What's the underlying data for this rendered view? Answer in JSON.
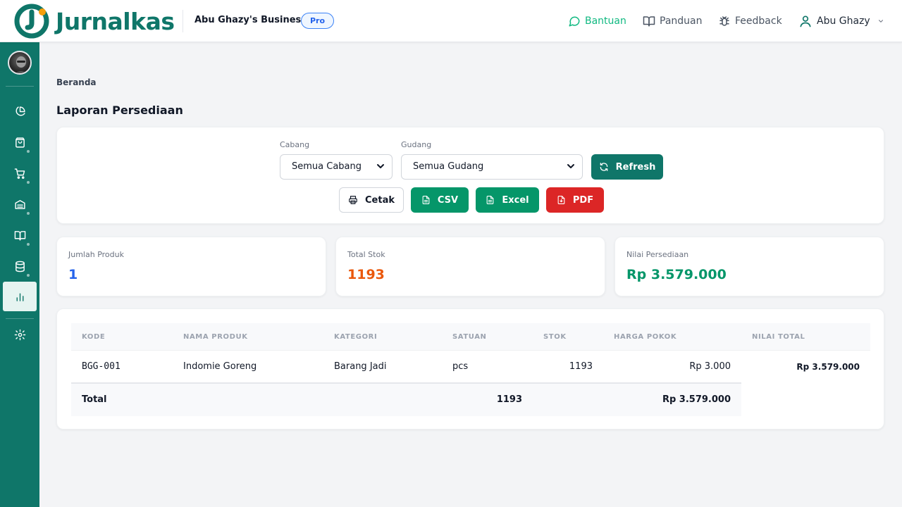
{
  "header": {
    "logo_text": "Jurnalkas",
    "business_name": "Abu Ghazy's Business",
    "plan_badge": "Pro",
    "links": {
      "bantuan": "Bantuan",
      "panduan": "Panduan",
      "feedback": "Feedback"
    },
    "user_name": "Abu Ghazy"
  },
  "sidebar": {
    "items": [
      {
        "icon": "pie-chart-icon"
      },
      {
        "icon": "shopping-bag-icon"
      },
      {
        "icon": "cart-icon"
      },
      {
        "icon": "archive-icon"
      },
      {
        "icon": "book-icon"
      },
      {
        "icon": "database-icon"
      },
      {
        "icon": "bar-chart-icon",
        "active": true
      },
      {
        "icon": "gear-icon"
      }
    ]
  },
  "breadcrumb": "Beranda",
  "page_title": "Laporan Persediaan",
  "filters": {
    "cabang_label": "Cabang",
    "cabang_value": "Semua Cabang",
    "gudang_label": "Gudang",
    "gudang_value": "Semua Gudang",
    "refresh_label": "Refresh",
    "cetak_label": "Cetak",
    "csv_label": "CSV",
    "excel_label": "Excel",
    "pdf_label": "PDF"
  },
  "stats": {
    "jumlah_produk": {
      "label": "Jumlah Produk",
      "value": "1",
      "color": "#2563eb"
    },
    "total_stok": {
      "label": "Total Stok",
      "value": "1193",
      "color": "#ea580c"
    },
    "nilai_persediaan": {
      "label": "Nilai Persediaan",
      "value": "Rp 3.579.000",
      "color": "#059669"
    }
  },
  "table": {
    "headers": [
      "KODE",
      "NAMA PRODUK",
      "KATEGORI",
      "SATUAN",
      "STOK",
      "HARGA POKOK",
      "NILAI TOTAL"
    ],
    "rows": [
      [
        "BGG-001",
        "Indomie Goreng",
        "Barang Jadi",
        "pcs",
        "1193",
        "Rp 3.000",
        "Rp 3.579.000"
      ]
    ],
    "footer": {
      "label": "Total",
      "stok": "1193",
      "nilai": "Rp 3.579.000"
    }
  },
  "colors": {
    "brand": "#0f7669",
    "accent_orange": "#f59e0b"
  }
}
